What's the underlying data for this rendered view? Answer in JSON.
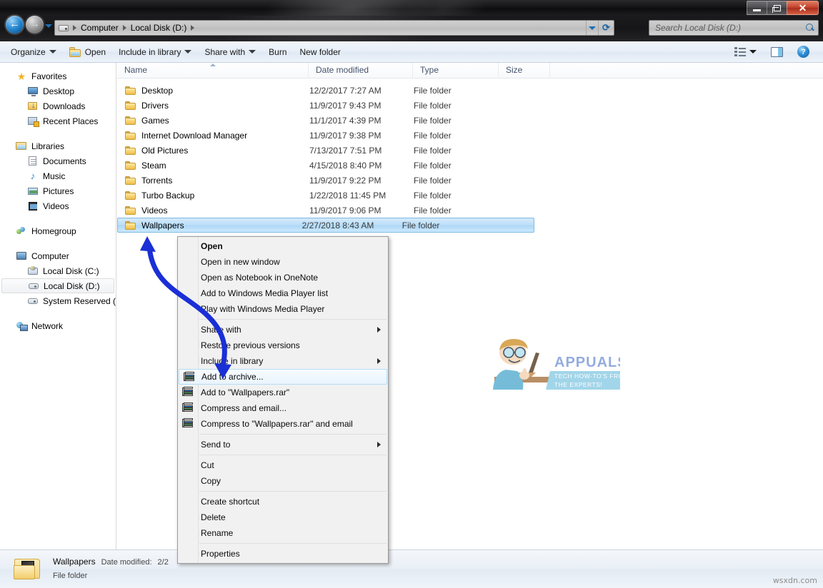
{
  "window": {
    "controls": {
      "minimize": "Minimize",
      "maximize": "Maximize",
      "close": "Close"
    }
  },
  "address": {
    "back_label": "Back",
    "forward_label": "Forward",
    "history_label": "Recent pages",
    "drive_icon": "drive-icon",
    "crumbs": [
      "Computer",
      "Local Disk (D:)"
    ],
    "dropdown_label": "Previous locations",
    "refresh_label": "Refresh"
  },
  "search": {
    "placeholder": "Search Local Disk (D:)",
    "icon": "search-icon"
  },
  "toolbar": {
    "organize": "Organize",
    "open": "Open",
    "include_in_library": "Include in library",
    "share_with": "Share with",
    "burn": "Burn",
    "new_folder": "New folder",
    "view_label": "Change your view",
    "preview_label": "Show the preview pane",
    "help_label": "Get help"
  },
  "sidebar": {
    "groups": [
      {
        "header": {
          "label": "Favorites",
          "icon": "star-icon"
        },
        "items": [
          {
            "label": "Desktop",
            "icon": "desktop-icon"
          },
          {
            "label": "Downloads",
            "icon": "downloads-icon"
          },
          {
            "label": "Recent Places",
            "icon": "recent-places-icon"
          }
        ]
      },
      {
        "header": {
          "label": "Libraries",
          "icon": "libraries-icon"
        },
        "items": [
          {
            "label": "Documents",
            "icon": "document-icon"
          },
          {
            "label": "Music",
            "icon": "music-note-icon"
          },
          {
            "label": "Pictures",
            "icon": "picture-icon"
          },
          {
            "label": "Videos",
            "icon": "video-icon"
          }
        ]
      },
      {
        "header": {
          "label": "Homegroup",
          "icon": "homegroup-icon"
        },
        "items": []
      },
      {
        "header": {
          "label": "Computer",
          "icon": "computer-icon"
        },
        "items": [
          {
            "label": "Local Disk (C:)",
            "icon": "system-drive-icon",
            "selected": false
          },
          {
            "label": "Local Disk (D:)",
            "icon": "drive-icon",
            "selected": true
          },
          {
            "label": "System Reserved (F:)",
            "icon": "drive-icon",
            "selected": false
          }
        ]
      },
      {
        "header": {
          "label": "Network",
          "icon": "network-icon"
        },
        "items": []
      }
    ]
  },
  "filelist": {
    "columns": [
      {
        "key": "name",
        "label": "Name",
        "sorted": true
      },
      {
        "key": "date",
        "label": "Date modified",
        "sorted": false
      },
      {
        "key": "type",
        "label": "Type",
        "sorted": false
      },
      {
        "key": "size",
        "label": "Size",
        "sorted": false
      }
    ],
    "rows": [
      {
        "name": "Desktop",
        "date": "12/2/2017 7:27 AM",
        "type": "File folder",
        "size": "",
        "selected": false
      },
      {
        "name": "Drivers",
        "date": "11/9/2017 9:43 PM",
        "type": "File folder",
        "size": "",
        "selected": false
      },
      {
        "name": "Games",
        "date": "11/1/2017 4:39 PM",
        "type": "File folder",
        "size": "",
        "selected": false
      },
      {
        "name": "Internet Download Manager",
        "date": "11/9/2017 9:38 PM",
        "type": "File folder",
        "size": "",
        "selected": false
      },
      {
        "name": "Old Pictures",
        "date": "7/13/2017 7:51 PM",
        "type": "File folder",
        "size": "",
        "selected": false
      },
      {
        "name": "Steam",
        "date": "4/15/2018 8:40 PM",
        "type": "File folder",
        "size": "",
        "selected": false
      },
      {
        "name": "Torrents",
        "date": "11/9/2017 9:22 PM",
        "type": "File folder",
        "size": "",
        "selected": false
      },
      {
        "name": "Turbo Backup",
        "date": "1/22/2018 11:45 PM",
        "type": "File folder",
        "size": "",
        "selected": false
      },
      {
        "name": "Videos",
        "date": "11/9/2017 9:06 PM",
        "type": "File folder",
        "size": "",
        "selected": false
      },
      {
        "name": "Wallpapers",
        "date": "2/27/2018 8:43 AM",
        "type": "File folder",
        "size": "",
        "selected": true
      }
    ]
  },
  "context_menu": {
    "items": [
      {
        "label": "Open",
        "bold": true,
        "icon": null,
        "submenu": false,
        "separator_after": false
      },
      {
        "label": "Open in new window",
        "bold": false,
        "icon": null,
        "submenu": false,
        "separator_after": false
      },
      {
        "label": "Open as Notebook in OneNote",
        "bold": false,
        "icon": null,
        "submenu": false,
        "separator_after": false
      },
      {
        "label": "Add to Windows Media Player list",
        "bold": false,
        "icon": null,
        "submenu": false,
        "separator_after": false
      },
      {
        "label": "Play with Windows Media Player",
        "bold": false,
        "icon": null,
        "submenu": false,
        "separator_after": true
      },
      {
        "label": "Share with",
        "bold": false,
        "icon": null,
        "submenu": true,
        "separator_after": false
      },
      {
        "label": "Restore previous versions",
        "bold": false,
        "icon": null,
        "submenu": false,
        "separator_after": false
      },
      {
        "label": "Include in library",
        "bold": false,
        "icon": null,
        "submenu": true,
        "separator_after": false
      },
      {
        "label": "Add to archive...",
        "bold": false,
        "icon": "winrar-icon",
        "submenu": false,
        "highlight": true,
        "separator_after": false
      },
      {
        "label": "Add to \"Wallpapers.rar\"",
        "bold": false,
        "icon": "winrar-icon",
        "submenu": false,
        "separator_after": false
      },
      {
        "label": "Compress and email...",
        "bold": false,
        "icon": "winrar-icon",
        "submenu": false,
        "separator_after": false
      },
      {
        "label": "Compress to \"Wallpapers.rar\" and email",
        "bold": false,
        "icon": "winrar-icon",
        "submenu": false,
        "separator_after": true
      },
      {
        "label": "Send to",
        "bold": false,
        "icon": null,
        "submenu": true,
        "separator_after": true
      },
      {
        "label": "Cut",
        "bold": false,
        "icon": null,
        "submenu": false,
        "separator_after": false
      },
      {
        "label": "Copy",
        "bold": false,
        "icon": null,
        "submenu": false,
        "separator_after": true
      },
      {
        "label": "Create shortcut",
        "bold": false,
        "icon": null,
        "submenu": false,
        "separator_after": false
      },
      {
        "label": "Delete",
        "bold": false,
        "icon": null,
        "submenu": false,
        "separator_after": false
      },
      {
        "label": "Rename",
        "bold": false,
        "icon": null,
        "submenu": false,
        "separator_after": true
      },
      {
        "label": "Properties",
        "bold": false,
        "icon": null,
        "submenu": false,
        "separator_after": false
      }
    ]
  },
  "statusbar": {
    "item_name": "Wallpapers",
    "date_label": "Date modified:",
    "date_value": "2/2",
    "item_type": "File folder",
    "icon": "folder-with-picture-icon"
  },
  "annotation": {
    "arrow_color": "#1a2fd6",
    "description": "blue s-curve arrow from Wallpapers row to Add to archive menu item"
  },
  "watermarks": {
    "logo_title": "APPUALS",
    "logo_tagline_line1": "TECH HOW-TO'S FROM",
    "logo_tagline_line2": "THE EXPERTS!",
    "site": "wsxdn.com"
  },
  "colors": {
    "selection_blue": "#bcdff9",
    "selection_border": "#7fb9e0",
    "menu_highlight": "#eaf4fd",
    "accent": "#2f8fd6",
    "close_red": "#c2402a"
  }
}
